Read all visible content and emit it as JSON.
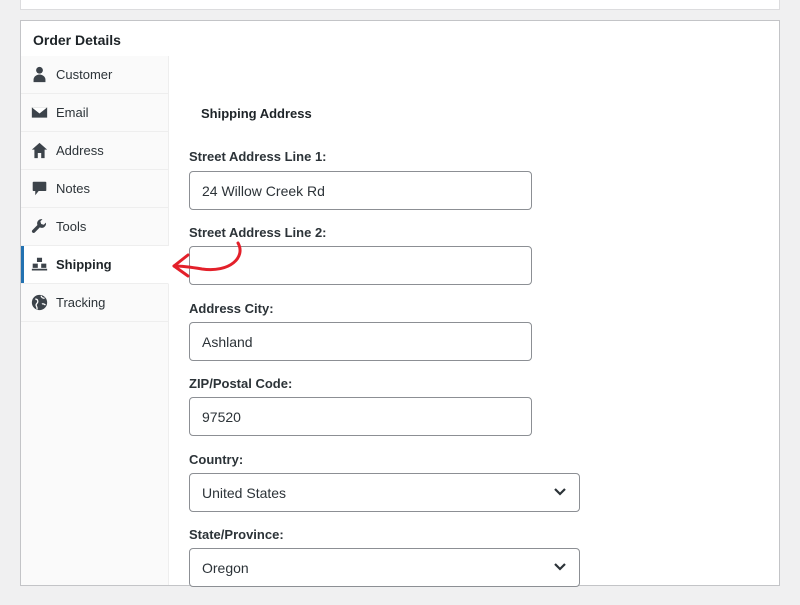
{
  "panel": {
    "title": "Order Details"
  },
  "tabs": [
    {
      "label": "Customer",
      "icon": "user-icon"
    },
    {
      "label": "Email",
      "icon": "envelope-icon"
    },
    {
      "label": "Address",
      "icon": "home-icon"
    },
    {
      "label": "Notes",
      "icon": "speech-bubble-icon"
    },
    {
      "label": "Tools",
      "icon": "wrench-icon"
    },
    {
      "label": "Shipping",
      "icon": "shipping-boxes-icon",
      "active": true
    },
    {
      "label": "Tracking",
      "icon": "globe-icon"
    }
  ],
  "shipping": {
    "heading": "Shipping Address",
    "street1": {
      "label": "Street Address Line 1:",
      "value": "24 Willow Creek Rd"
    },
    "street2": {
      "label": "Street Address Line 2:",
      "value": ""
    },
    "city": {
      "label": "Address City:",
      "value": "Ashland"
    },
    "zip": {
      "label": "ZIP/Postal Code:",
      "value": "97520"
    },
    "country": {
      "label": "Country:",
      "value": "United States"
    },
    "state": {
      "label": "State/Province:",
      "value": "Oregon"
    }
  },
  "colors": {
    "accent": "#2271b1",
    "annotation": "#e3202a"
  }
}
